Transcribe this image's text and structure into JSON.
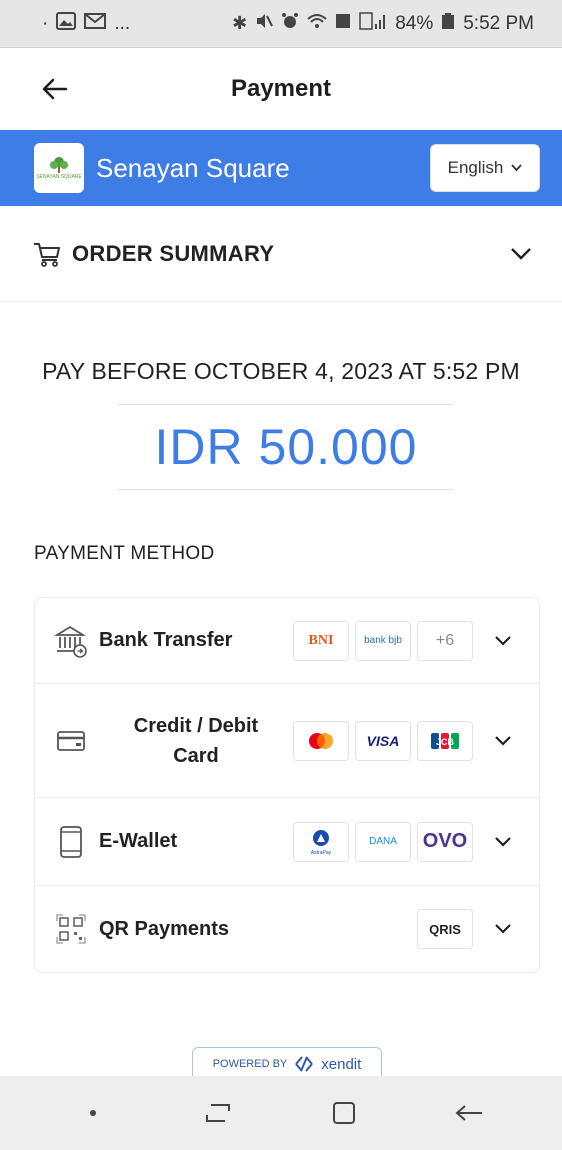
{
  "status_bar": {
    "left_text": "·",
    "left_more": "...",
    "battery": "84%",
    "time": "5:52 PM",
    "left_icons": [
      "gallery-icon",
      "mail-icon"
    ],
    "right_icons": [
      "bluetooth-icon",
      "mute-icon",
      "alarm-icon",
      "wifi-icon",
      "data-icon",
      "signal-icon"
    ]
  },
  "header": {
    "title": "Payment",
    "back_icon": "arrow-left-icon"
  },
  "merchant": {
    "name": "Senayan Square",
    "logo_text": "SENAYAN SQUARE",
    "language": "English",
    "accent_color": "#3f7de6"
  },
  "order_summary": {
    "label": "ORDER SUMMARY"
  },
  "payment": {
    "pay_before": "PAY BEFORE OCTOBER 4, 2023 AT 5:52 PM",
    "amount": "IDR 50.000"
  },
  "payment_methods": {
    "title": "PAYMENT METHOD",
    "items": [
      {
        "label": "Bank Transfer",
        "icon": "bank-icon",
        "logos": [
          "BNI",
          "bank bjb",
          "+6"
        ]
      },
      {
        "label": "Credit / Debit Card",
        "label_line1": "Credit / Debit",
        "label_line2": "Card",
        "icon": "card-icon",
        "logos": [
          "mastercard",
          "VISA",
          "JCB"
        ]
      },
      {
        "label": "E-Wallet",
        "icon": "phone-icon",
        "logos": [
          "AstraPay",
          "DANA",
          "OVO"
        ]
      },
      {
        "label": "QR Payments",
        "icon": "qr-icon",
        "logos": [
          "QRIS"
        ]
      }
    ]
  },
  "footer": {
    "powered_by": "POWERED BY",
    "provider": "xendit"
  }
}
